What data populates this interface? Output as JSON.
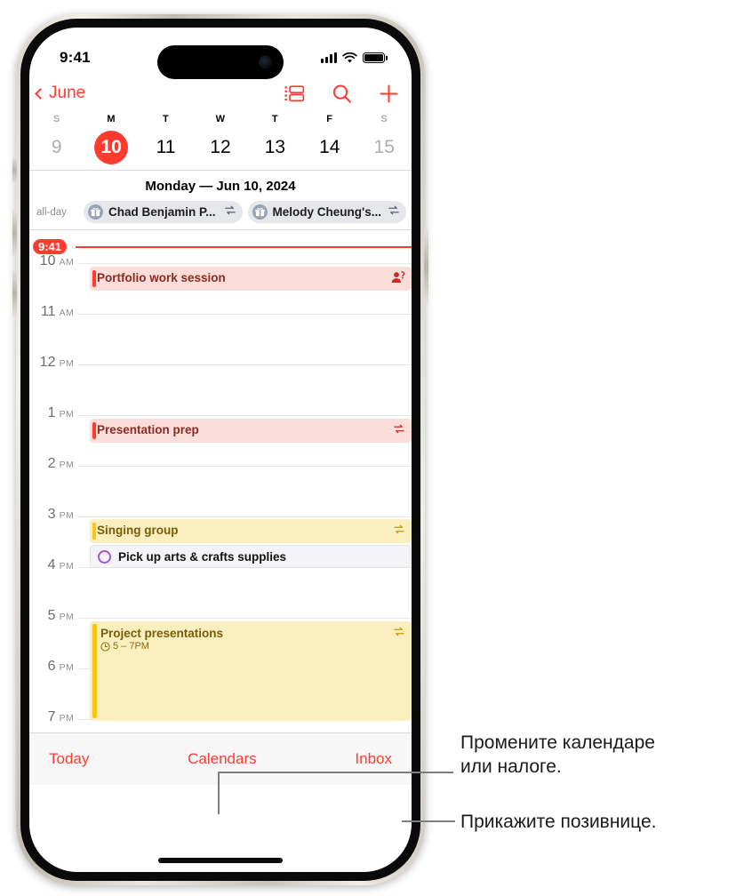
{
  "status_bar": {
    "time": "9:41",
    "signal_icon": "cellular-bars-icon",
    "wifi_icon": "wifi-icon",
    "battery_icon": "battery-icon"
  },
  "nav_bar": {
    "back_label": "June",
    "back_icon": "chevron-left-icon",
    "list_view_icon": "day-list-view-icon",
    "search_icon": "search-icon",
    "add_icon": "plus-icon"
  },
  "week_strip": {
    "weekday_labels": [
      "S",
      "M",
      "T",
      "W",
      "T",
      "F",
      "S"
    ],
    "days": [
      {
        "num": "9",
        "state": "weekend"
      },
      {
        "num": "10",
        "state": "selected"
      },
      {
        "num": "11",
        "state": "weekday"
      },
      {
        "num": "12",
        "state": "weekday"
      },
      {
        "num": "13",
        "state": "weekday"
      },
      {
        "num": "14",
        "state": "weekday"
      },
      {
        "num": "15",
        "state": "weekend"
      }
    ]
  },
  "day_header": "Monday — Jun 10, 2024",
  "all_day": {
    "label": "all-day",
    "events": [
      {
        "title": "Chad Benjamin P...",
        "avatar_icon": "gift-icon",
        "repeat_icon": "repeat-icon"
      },
      {
        "title": "Melody Cheung's...",
        "avatar_icon": "gift-icon",
        "repeat_icon": "repeat-icon"
      }
    ]
  },
  "timeline": {
    "now_time": "9:41",
    "hours": [
      {
        "num": "10",
        "period": "AM"
      },
      {
        "num": "11",
        "period": "AM"
      },
      {
        "num": "12",
        "period": "PM"
      },
      {
        "num": "1",
        "period": "PM"
      },
      {
        "num": "2",
        "period": "PM"
      },
      {
        "num": "3",
        "period": "PM"
      },
      {
        "num": "4",
        "period": "PM"
      },
      {
        "num": "5",
        "period": "PM"
      },
      {
        "num": "6",
        "period": "PM"
      },
      {
        "num": "7",
        "period": "PM"
      }
    ],
    "events": [
      {
        "title": "Portfolio work session",
        "subtitle": "",
        "color": "red",
        "icon": "person-question-icon"
      },
      {
        "title": "Presentation prep",
        "subtitle": "",
        "color": "red",
        "icon": "repeat-icon"
      },
      {
        "title": "Singing group",
        "subtitle": "",
        "color": "yellow",
        "icon": "repeat-icon"
      },
      {
        "title": "Project presentations",
        "subtitle": "5 – 7PM",
        "color": "yellow",
        "icon": "repeat-icon",
        "time_icon": "clock-icon"
      }
    ],
    "reminder": {
      "title": "Pick up arts & crafts supplies",
      "checkbox_icon": "circle-unchecked-icon"
    }
  },
  "toolbar": {
    "today": "Today",
    "calendars": "Calendars",
    "inbox": "Inbox"
  },
  "callouts": [
    {
      "line1": "Промените календаре",
      "line2": "или налоге."
    },
    {
      "line1": "Прикажите позивнице.",
      "line2": ""
    }
  ],
  "colors": {
    "accent": "#FF3B30",
    "event_yellow": "#F5C518",
    "reminder_purple": "#A855C8"
  }
}
